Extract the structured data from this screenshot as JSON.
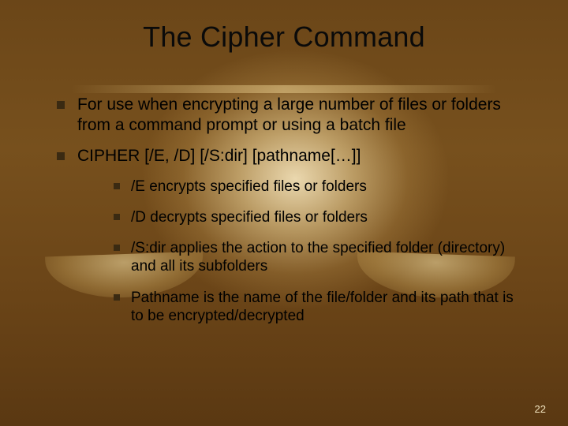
{
  "title": "The Cipher Command",
  "bullets": {
    "main": [
      "For use when encrypting a large number of files or folders from a command prompt or using a batch file",
      "CIPHER [/E, /D] [/S:dir] [pathname[…]]"
    ],
    "sub": [
      "/E encrypts specified files or folders",
      "/D decrypts specified files or folders",
      "/S:dir applies the action to the specified folder (directory) and all its subfolders",
      "Pathname is the name of the file/folder and its path that is to be encrypted/decrypted"
    ]
  },
  "page_number": "22"
}
